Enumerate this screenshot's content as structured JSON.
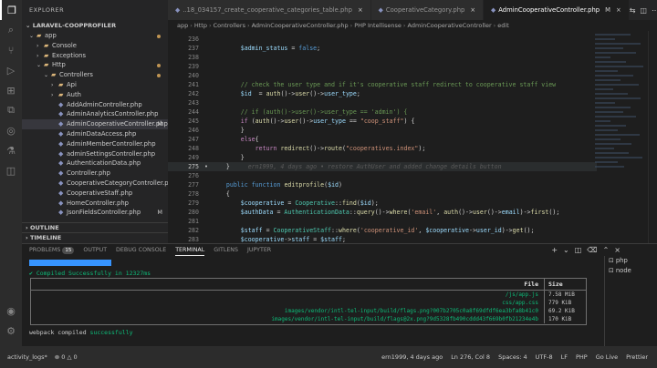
{
  "sidebar": {
    "header": "EXPLORER",
    "project": "LARAVEL-COOPPROFILER",
    "tree": [
      {
        "label": "app",
        "type": "folder",
        "depth": 1,
        "open": true,
        "dot": true
      },
      {
        "label": "Console",
        "type": "folder",
        "depth": 2,
        "open": false
      },
      {
        "label": "Exceptions",
        "type": "folder",
        "depth": 2,
        "open": false
      },
      {
        "label": "Http",
        "type": "folder",
        "depth": 2,
        "open": true,
        "dot": true
      },
      {
        "label": "Controllers",
        "type": "folder",
        "depth": 3,
        "open": true,
        "dot": true
      },
      {
        "label": "Api",
        "type": "folder",
        "depth": 4,
        "open": false
      },
      {
        "label": "Auth",
        "type": "folder",
        "depth": 4,
        "open": false
      },
      {
        "label": "AddAdminController.php",
        "type": "php",
        "depth": 4
      },
      {
        "label": "AdminAnalyticsController.php",
        "type": "php",
        "depth": 4
      },
      {
        "label": "AdminCooperativeController.php",
        "type": "php",
        "depth": 4,
        "selected": true,
        "badge": "M"
      },
      {
        "label": "AdminDataAccess.php",
        "type": "php",
        "depth": 4
      },
      {
        "label": "AdminMemberController.php",
        "type": "php",
        "depth": 4
      },
      {
        "label": "adminSettingsController.php",
        "type": "php",
        "depth": 4
      },
      {
        "label": "AuthenticationData.php",
        "type": "php",
        "depth": 4
      },
      {
        "label": "Controller.php",
        "type": "php",
        "depth": 4
      },
      {
        "label": "CooperativeCategoryController.php",
        "type": "php",
        "depth": 4
      },
      {
        "label": "CooperativeStaff.php",
        "type": "php",
        "depth": 4
      },
      {
        "label": "HomeController.php",
        "type": "php",
        "depth": 4
      },
      {
        "label": "JsonFieldsController.php",
        "type": "php",
        "depth": 4,
        "badge": "M"
      }
    ],
    "outline": "OUTLINE",
    "timeline": "TIMELINE"
  },
  "tabs": [
    {
      "label": "..18_034157_create_cooperative_categories_table.php",
      "active": false
    },
    {
      "label": "CooperativeCategory.php",
      "active": false
    },
    {
      "label": "AdminCooperativeController.php",
      "active": true,
      "mark": "M"
    }
  ],
  "breadcrumb": [
    "app",
    "Http",
    "Controllers",
    "AdminCooperativeController.php",
    "PHP Intellisense",
    "AdminCooperativeController",
    "edit"
  ],
  "editor": {
    "lines": [
      {
        "n": "236",
        "segs": [
          [
            "",
            ""
          ]
        ]
      },
      {
        "n": "237",
        "segs": [
          [
            "        ",
            ""
          ],
          [
            "$admin_status",
            "t-var"
          ],
          [
            " = ",
            ""
          ],
          [
            "false",
            "t-kw2"
          ],
          [
            ";",
            ""
          ]
        ]
      },
      {
        "n": "238",
        "segs": [
          [
            "",
            ""
          ]
        ]
      },
      {
        "n": "239",
        "segs": [
          [
            "",
            ""
          ]
        ]
      },
      {
        "n": "240",
        "segs": [
          [
            "",
            ""
          ]
        ]
      },
      {
        "n": "241",
        "segs": [
          [
            "        ",
            ""
          ],
          [
            "// check the user type and if it's cooperative staff redirect to cooperative staff view",
            "t-cmt"
          ]
        ]
      },
      {
        "n": "242",
        "segs": [
          [
            "        ",
            ""
          ],
          [
            "$id",
            "t-var"
          ],
          [
            "  = ",
            ""
          ],
          [
            "auth",
            "t-fn"
          ],
          [
            "()->",
            ""
          ],
          [
            "user",
            "t-fn"
          ],
          [
            "()->",
            ""
          ],
          [
            "user_type",
            "t-var"
          ],
          [
            ";",
            ""
          ]
        ]
      },
      {
        "n": "243",
        "segs": [
          [
            "",
            ""
          ]
        ]
      },
      {
        "n": "244",
        "segs": [
          [
            "        ",
            ""
          ],
          [
            "// if (auth()->user()->user_type == 'admin') {",
            "t-cmt"
          ]
        ]
      },
      {
        "n": "245",
        "segs": [
          [
            "        ",
            ""
          ],
          [
            "if",
            "t-kw"
          ],
          [
            " (",
            ""
          ],
          [
            "auth",
            "t-fn"
          ],
          [
            "()->",
            ""
          ],
          [
            "user",
            "t-fn"
          ],
          [
            "()->",
            ""
          ],
          [
            "user_type",
            "t-var"
          ],
          [
            " == ",
            ""
          ],
          [
            "\"coop_staff\"",
            "t-str"
          ],
          [
            ") {",
            ""
          ]
        ]
      },
      {
        "n": "246",
        "segs": [
          [
            "        }",
            ""
          ]
        ]
      },
      {
        "n": "247",
        "segs": [
          [
            "        ",
            ""
          ],
          [
            "else",
            "t-kw"
          ],
          [
            "{",
            ""
          ]
        ]
      },
      {
        "n": "248",
        "segs": [
          [
            "            ",
            ""
          ],
          [
            "return",
            "t-kw"
          ],
          [
            " ",
            ""
          ],
          [
            "redirect",
            "t-fn"
          ],
          [
            "()->",
            ""
          ],
          [
            "route",
            "t-fn"
          ],
          [
            "(",
            ""
          ],
          [
            "\"cooperatives.index\"",
            "t-str"
          ],
          [
            ");",
            ""
          ]
        ]
      },
      {
        "n": "249",
        "segs": [
          [
            "        }",
            ""
          ]
        ]
      },
      {
        "n": "275",
        "segs": [
          [
            "    }",
            ""
          ],
          [
            "     ern1999, 4 days ago • restore AuthUser and added change details button",
            "t-ghost"
          ]
        ],
        "current": true
      },
      {
        "n": "276",
        "segs": [
          [
            "",
            ""
          ]
        ]
      },
      {
        "n": "277",
        "segs": [
          [
            "    ",
            ""
          ],
          [
            "public",
            "t-kw2"
          ],
          [
            " ",
            ""
          ],
          [
            "function",
            "t-kw2"
          ],
          [
            " ",
            ""
          ],
          [
            "editprofile",
            "t-fn"
          ],
          [
            "(",
            ""
          ],
          [
            "$id",
            "t-var"
          ],
          [
            ")",
            ""
          ]
        ]
      },
      {
        "n": "278",
        "segs": [
          [
            "    {",
            ""
          ]
        ]
      },
      {
        "n": "279",
        "segs": [
          [
            "        ",
            ""
          ],
          [
            "$cooperative",
            "t-var"
          ],
          [
            " = ",
            ""
          ],
          [
            "Cooperative",
            "t-cls"
          ],
          [
            "::",
            ""
          ],
          [
            "find",
            "t-fn"
          ],
          [
            "(",
            ""
          ],
          [
            "$id",
            "t-var"
          ],
          [
            ");",
            ""
          ]
        ]
      },
      {
        "n": "280",
        "segs": [
          [
            "        ",
            ""
          ],
          [
            "$authData",
            "t-var"
          ],
          [
            " = ",
            ""
          ],
          [
            "AuthenticationData",
            "t-cls"
          ],
          [
            "::",
            ""
          ],
          [
            "query",
            "t-fn"
          ],
          [
            "()->",
            ""
          ],
          [
            "where",
            "t-fn"
          ],
          [
            "(",
            ""
          ],
          [
            "'email'",
            "t-str"
          ],
          [
            ", ",
            ""
          ],
          [
            "auth",
            "t-fn"
          ],
          [
            "()->",
            ""
          ],
          [
            "user",
            "t-fn"
          ],
          [
            "()->",
            ""
          ],
          [
            "email",
            "t-var"
          ],
          [
            ")->",
            ""
          ],
          [
            "first",
            "t-fn"
          ],
          [
            "();",
            ""
          ]
        ]
      },
      {
        "n": "281",
        "segs": [
          [
            "",
            ""
          ]
        ]
      },
      {
        "n": "282",
        "segs": [
          [
            "        ",
            ""
          ],
          [
            "$staff",
            "t-var"
          ],
          [
            " = ",
            ""
          ],
          [
            "CooperativeStaff",
            "t-cls"
          ],
          [
            "::",
            ""
          ],
          [
            "where",
            "t-fn"
          ],
          [
            "(",
            ""
          ],
          [
            "'cooperative_id'",
            "t-str"
          ],
          [
            ", ",
            ""
          ],
          [
            "$cooperative",
            "t-var"
          ],
          [
            "->",
            ""
          ],
          [
            "user_id",
            "t-var"
          ],
          [
            ")->",
            ""
          ],
          [
            "get",
            "t-fn"
          ],
          [
            "();",
            ""
          ]
        ]
      },
      {
        "n": "283",
        "segs": [
          [
            "        ",
            ""
          ],
          [
            "$cooperative",
            "t-var"
          ],
          [
            "->",
            ""
          ],
          [
            "staff",
            "t-var"
          ],
          [
            " = ",
            ""
          ],
          [
            "$staff",
            "t-var"
          ],
          [
            ";",
            ""
          ]
        ]
      }
    ]
  },
  "panel": {
    "tabs": [
      {
        "label": "PROBLEMS",
        "count": "15"
      },
      {
        "label": "OUTPUT"
      },
      {
        "label": "DEBUG CONSOLE"
      },
      {
        "label": "TERMINAL",
        "active": true
      },
      {
        "label": "GITLENS"
      },
      {
        "label": "JUPYTER"
      }
    ],
    "progress_fraction": 1.0,
    "compiled_msg": "✔ Compiled Successfully in 12327ms",
    "table_head": {
      "file": "File",
      "size": "Size"
    },
    "table_rows": [
      {
        "file": "/js/app.js",
        "size": "7.58 MiB"
      },
      {
        "file": "css/app.css",
        "size": "779 KiB"
      },
      {
        "file": "images/vendor/intl-tel-input/build/flags.png?007b2705c0a8f69dfdf6ea3bfa8b41c0",
        "size": "69.2 KiB"
      },
      {
        "file": "images/vendor/intl-tel-input/build/flags@2x.png?9d5328fb490cddd43f669b0fb21234e4b",
        "size": "170 KiB"
      }
    ],
    "webpack_prefix": "webpack compiled ",
    "webpack_status": "successfully",
    "shells": [
      "php",
      "node"
    ]
  },
  "status": {
    "left": [
      "activity_logs*",
      "⊗ 0 △ 0"
    ],
    "right": [
      "ern1999, 4 days ago",
      "Ln 276, Col 8",
      "Spaces: 4",
      "UTF-8",
      "LF",
      "PHP",
      "Go Live",
      "Prettier"
    ]
  }
}
